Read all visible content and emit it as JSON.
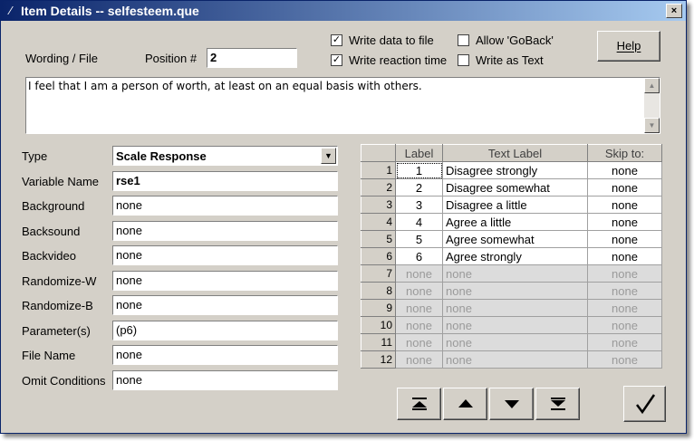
{
  "window": {
    "title": "Item Details -- selfesteem.que",
    "close_label": "×"
  },
  "header": {
    "wording_label": "Wording / File",
    "position_label": "Position #",
    "position_value": "2",
    "help_label": "Help"
  },
  "options": {
    "write_data": {
      "label": "Write data to file",
      "checked": true
    },
    "write_rt": {
      "label": "Write reaction time",
      "checked": true
    },
    "allow_goback": {
      "label": "Allow 'GoBack'",
      "checked": false
    },
    "write_text": {
      "label": "Write as Text",
      "checked": false
    }
  },
  "wording_text": "I feel that I am a person of worth, at least on an equal basis with others.",
  "fields": {
    "type": {
      "label": "Type",
      "value": "Scale Response"
    },
    "variable_name": {
      "label": "Variable Name",
      "value": "rse1"
    },
    "background": {
      "label": "Background",
      "value": "none"
    },
    "backsound": {
      "label": "Backsound",
      "value": "none"
    },
    "backvideo": {
      "label": "Backvideo",
      "value": "none"
    },
    "randomize_w": {
      "label": "Randomize-W",
      "value": "none"
    },
    "randomize_b": {
      "label": "Randomize-B",
      "value": "none"
    },
    "parameters": {
      "label": "Parameter(s)",
      "value": "(p6)"
    },
    "file_name": {
      "label": "File Name",
      "value": "none"
    },
    "omit_conditions": {
      "label": "Omit Conditions",
      "value": "none"
    }
  },
  "grid": {
    "headers": [
      "Label",
      "Text Label",
      "Skip to:"
    ],
    "rows": [
      {
        "n": "1",
        "label": "1",
        "text": "Disagree strongly",
        "skip": "none"
      },
      {
        "n": "2",
        "label": "2",
        "text": "Disagree somewhat",
        "skip": "none"
      },
      {
        "n": "3",
        "label": "3",
        "text": "Disagree a little",
        "skip": "none"
      },
      {
        "n": "4",
        "label": "4",
        "text": "Agree a little",
        "skip": "none"
      },
      {
        "n": "5",
        "label": "5",
        "text": "Agree somewhat",
        "skip": "none"
      },
      {
        "n": "6",
        "label": "6",
        "text": "Agree strongly",
        "skip": "none"
      },
      {
        "n": "7",
        "label": "none",
        "text": "none",
        "skip": "none"
      },
      {
        "n": "8",
        "label": "none",
        "text": "none",
        "skip": "none"
      },
      {
        "n": "9",
        "label": "none",
        "text": "none",
        "skip": "none"
      },
      {
        "n": "10",
        "label": "none",
        "text": "none",
        "skip": "none"
      },
      {
        "n": "11",
        "label": "none",
        "text": "none",
        "skip": "none"
      },
      {
        "n": "12",
        "label": "none",
        "text": "none",
        "skip": "none"
      }
    ]
  },
  "icons": {
    "nav": [
      "move-to-top-icon",
      "move-up-icon",
      "move-down-icon",
      "move-to-bottom-icon"
    ],
    "ok": "checkmark-icon"
  }
}
